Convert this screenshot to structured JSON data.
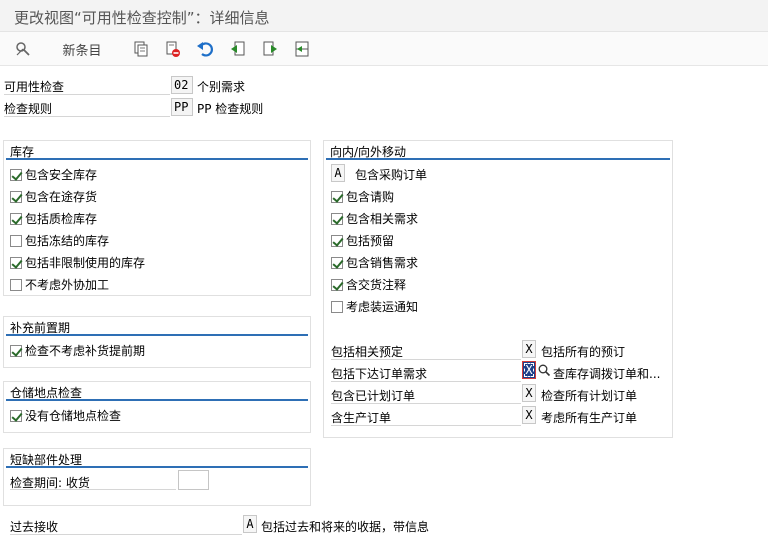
{
  "window": {
    "title": "更改视图“可用性检查控制”：详细信息"
  },
  "toolbar": {
    "new_entries": "新条目",
    "icons": [
      "display-change-icon",
      "copy-icon",
      "delete-icon",
      "undo-icon",
      "previous-entry-icon",
      "next-entry-icon",
      "select-block-icon"
    ]
  },
  "header": {
    "availability_check_label": "可用性检查",
    "availability_check_value": "02",
    "availability_check_desc": "个别需求",
    "check_rule_label": "检查规则",
    "check_rule_value": "PP",
    "check_rule_desc": "PP 检查规则"
  },
  "stock": {
    "title": "库存",
    "items": [
      {
        "label": "包含安全库存",
        "checked": true
      },
      {
        "label": "包含在途存货",
        "checked": true
      },
      {
        "label": "包括质检库存",
        "checked": true
      },
      {
        "label": "包括冻结的库存",
        "checked": false
      },
      {
        "label": "包括非限制使用的库存",
        "checked": true
      },
      {
        "label": "不考虑外协加工",
        "checked": false
      }
    ]
  },
  "replenishment": {
    "title": "补充前置期",
    "item": {
      "label": "检查不考虑补货提前期",
      "checked": true
    }
  },
  "storage": {
    "title": "仓储地点检查",
    "item": {
      "label": "没有仓储地点检查",
      "checked": true
    }
  },
  "missing_parts": {
    "title": "短缺部件处理",
    "check_period_label": "检查期间: 收货",
    "check_period_value": ""
  },
  "past_receipts": {
    "label": "过去接收",
    "value": "A",
    "desc": "包括过去和将来的收据，带信息"
  },
  "in_out": {
    "title": "向内/向外移动",
    "po_value": "A",
    "po_label": "包含采购订单",
    "items": [
      {
        "label": "包含请购",
        "checked": true
      },
      {
        "label": "包含相关需求",
        "checked": true
      },
      {
        "label": "包括预留",
        "checked": true
      },
      {
        "label": "包含销售需求",
        "checked": true
      },
      {
        "label": "含交货注释",
        "checked": true
      },
      {
        "label": "考虑装运通知",
        "checked": false
      }
    ],
    "rows": [
      {
        "label": "包括相关预定",
        "value": "X",
        "desc": "包括所有的预订"
      },
      {
        "label": "包括下达订单需求",
        "value": "X",
        "desc": "查库存调拨订单和..."
      },
      {
        "label": "包含已计划订单",
        "value": "X",
        "desc": "检查所有计划订单"
      },
      {
        "label": "含生产订单",
        "value": "X",
        "desc": "考虑所有生产订单"
      }
    ]
  }
}
